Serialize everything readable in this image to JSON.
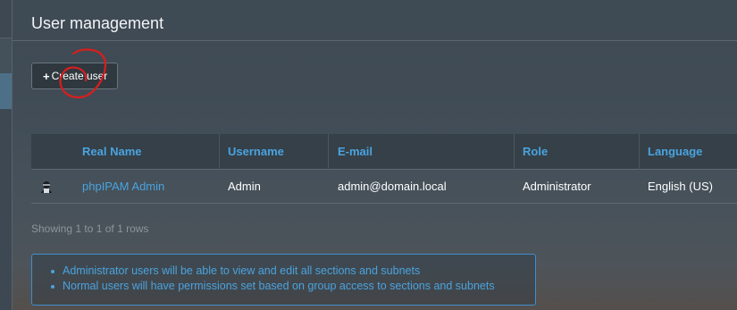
{
  "page": {
    "title": "User management"
  },
  "toolbar": {
    "create_icon": "plus-icon",
    "create_label": "Create user"
  },
  "table": {
    "columns": [
      "Real Name",
      "Username",
      "E-mail",
      "Role",
      "Language"
    ],
    "rows": [
      {
        "avatar_icon": "user-avatar-icon",
        "real_name": "phpIPAM Admin",
        "username": "Admin",
        "email": "admin@domain.local",
        "role": "Administrator",
        "language": "English (US)"
      }
    ]
  },
  "pagination": {
    "summary": "Showing 1 to 1 of 1 rows"
  },
  "info": {
    "items": [
      "Administrator users will be able to view and edit all sections and subnets",
      "Normal users will have permissions set based on group access to sections and subnets"
    ]
  },
  "colors": {
    "link": "#4aa3df",
    "annotation": "#d81e1e",
    "info_border": "#3f8ed0"
  }
}
